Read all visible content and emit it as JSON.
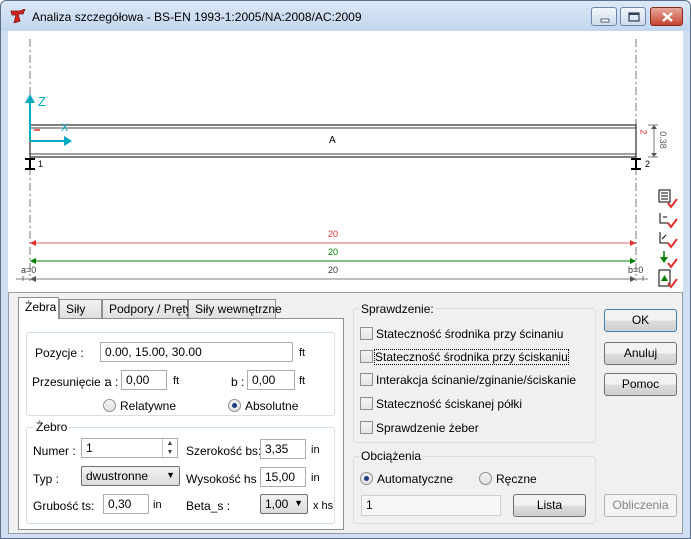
{
  "window": {
    "title": "Analiza szczegółowa - BS-EN 1993-1:2005/NA:2008/AC:2009"
  },
  "canvas": {
    "axis_z": "Z",
    "axis_x": "X",
    "beam_label": "A",
    "node_left": "1",
    "node_right": "2",
    "node_right_top": "2",
    "height_dim": "0.38",
    "dim_red": "20",
    "dim_green": "20",
    "dim_black": "20",
    "a_label": "a=0",
    "b_label": "b=0",
    "colors": {
      "red": "#e03030",
      "green": "#008000",
      "cyan": "#00a8c0",
      "dim": "#555555"
    }
  },
  "tabs": [
    "Żebra",
    "Siły",
    "Podpory / Pręty",
    "Siły wewnętrzne"
  ],
  "positions": {
    "label": "Pozycje :",
    "value": "0.00, 15.00, 30.00",
    "unit": "ft",
    "offset_label": "Przesunięcie :",
    "a_label": "a :",
    "a_value": "0,00",
    "a_unit": "ft",
    "b_label": "b :",
    "b_value": "0,00",
    "b_unit": "ft",
    "relative_label": "Relatywne",
    "absolute_label": "Absolutne"
  },
  "rib": {
    "group_title": "Żebro",
    "number_label": "Numer :",
    "number_value": "1",
    "type_label": "Typ :",
    "type_value": "dwustronne",
    "thickness_label": "Grubość ts:",
    "thickness_value": "0,30",
    "thickness_unit": "in",
    "width_label": "Szerokość bs:",
    "width_value": "3,35",
    "width_unit": "in",
    "height_label": "Wysokość hs :",
    "height_value": "15,00",
    "height_unit": "in",
    "beta_label": "Beta_s :",
    "beta_value": "1,00",
    "beta_unit": "x  hs"
  },
  "checks": {
    "group_title": "Sprawdzenie:",
    "items": [
      "Stateczność środnika przy ścinaniu",
      "Stateczność środnika przy ściskaniu",
      "Interakcja ścinanie/zginanie/ściskanie",
      "Stateczność ściskanej półki",
      "Sprawdzenie żeber"
    ]
  },
  "loads": {
    "group_title": "Obciążenia",
    "auto_label": "Automatyczne",
    "manual_label": "Ręczne",
    "field_value": "1",
    "list_button": "Lista"
  },
  "buttons": {
    "ok": "OK",
    "cancel": "Anuluj",
    "help": "Pomoc",
    "calc": "Obliczenia"
  }
}
